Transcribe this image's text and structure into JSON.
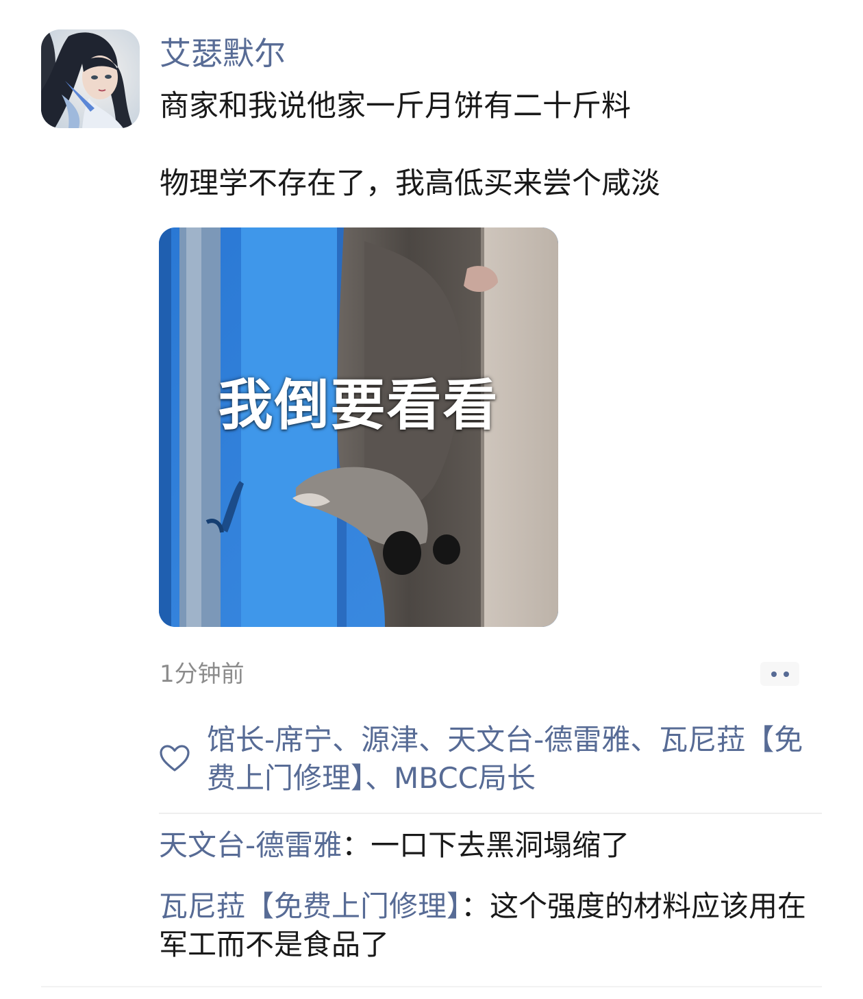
{
  "post": {
    "author": "艾瑟默尔",
    "text_line1": "商家和我说他家一斤月饼有二十斤料",
    "text_line2": "物理学不存在了，我高低买来尝个咸淡",
    "image_caption": "我倒要看看",
    "timestamp": "1分钟前"
  },
  "likes": {
    "icon": "heart-outline-icon",
    "names": "馆长-席宁、源津、天文台-德雷雅、瓦尼菈【免费上门修理】、MBCC局长"
  },
  "comments": [
    {
      "author": "天文台-德雷雅",
      "separator": "：",
      "text": "一口下去黑洞塌缩了"
    },
    {
      "author": "瓦尼菈【免费上门修理】",
      "separator": "：",
      "text": "这个强度的材料应该用在军工而不是食品了"
    }
  ],
  "colors": {
    "link": "#576b95",
    "text": "#191919",
    "meta": "#8c8c8c"
  }
}
